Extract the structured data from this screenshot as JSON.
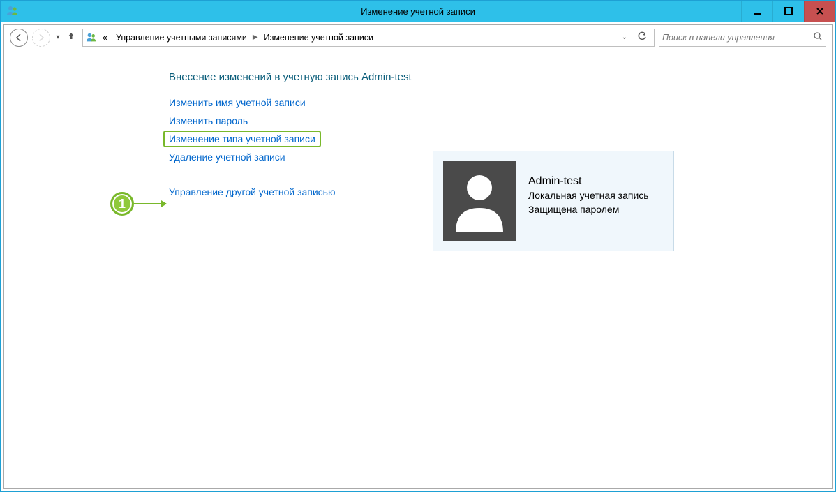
{
  "window": {
    "title": "Изменение учетной записи"
  },
  "breadcrumb": {
    "prefix": "«",
    "part1": "Управление учетными записями",
    "part2": "Изменение учетной записи"
  },
  "search": {
    "placeholder": "Поиск в панели управления"
  },
  "heading": "Внесение изменений в учетную запись Admin-test",
  "links": {
    "change_name": "Изменить имя учетной записи",
    "change_password": "Изменить пароль",
    "change_type": "Изменение типа учетной записи",
    "delete_account": "Удаление учетной записи",
    "manage_other": "Управление другой учетной записью"
  },
  "annotation": {
    "number": "1"
  },
  "account": {
    "name": "Admin-test",
    "type": "Локальная учетная запись",
    "protection": "Защищена паролем"
  }
}
